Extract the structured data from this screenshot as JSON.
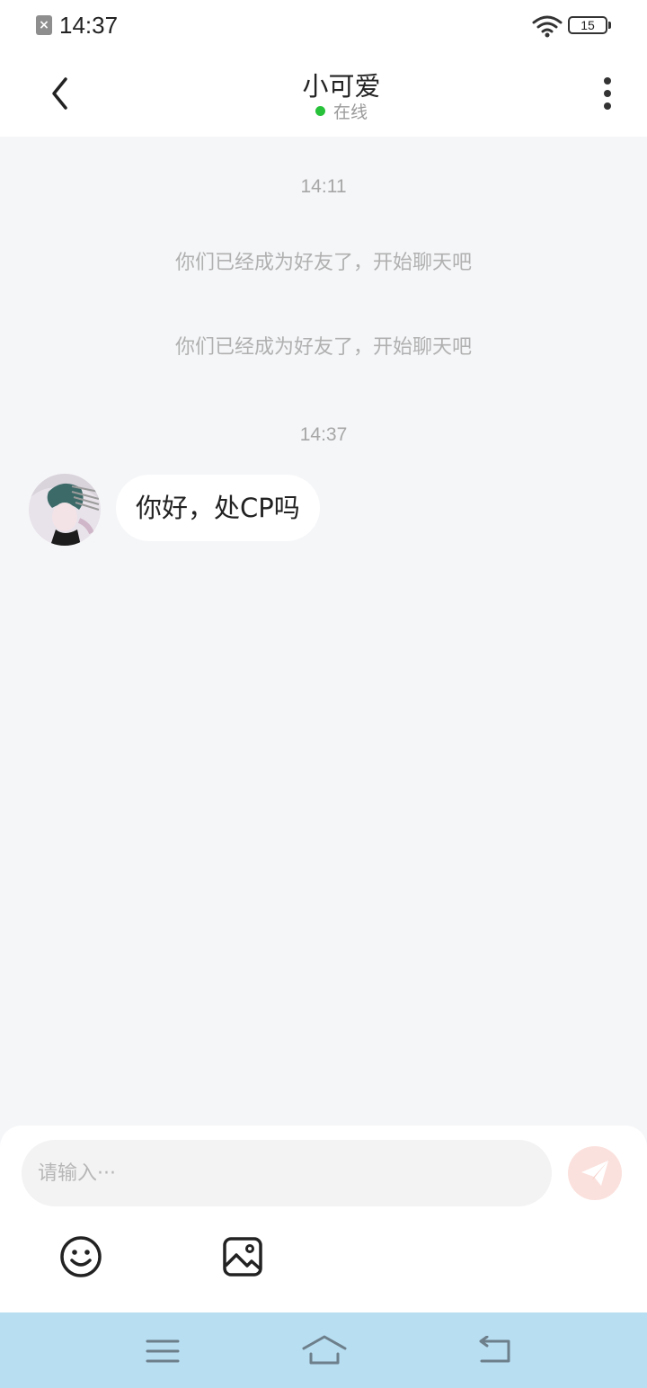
{
  "status_bar": {
    "time": "14:37",
    "battery": "15",
    "sim_glyph": "×"
  },
  "header": {
    "title": "小可爱",
    "status": "在线"
  },
  "chat": {
    "time_1": "14:11",
    "system_1": "你们已经成为好友了，开始聊天吧",
    "system_2": "你们已经成为好友了，开始聊天吧",
    "time_2": "14:37",
    "message_1": "你好，处CP吗"
  },
  "input": {
    "placeholder": "请输入···"
  },
  "icons": {
    "back": "back-icon",
    "more": "more-vertical-icon",
    "send": "send-icon",
    "emoji": "emoji-icon",
    "image": "image-icon",
    "wifi": "wifi-icon"
  },
  "colors": {
    "online_dot": "#27c13a",
    "send_button_bg": "#fbe1dd",
    "nav_bar_bg": "#b8def2"
  }
}
